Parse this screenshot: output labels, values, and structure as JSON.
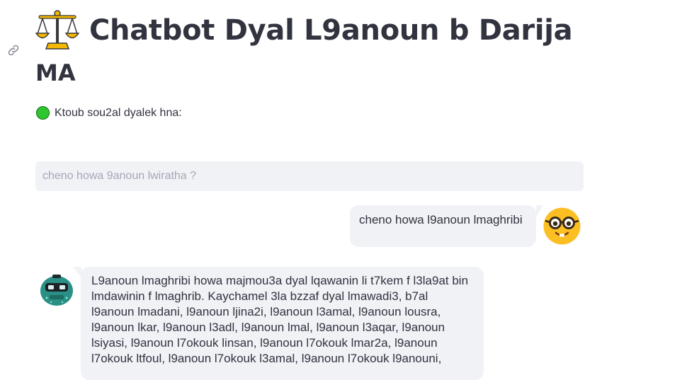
{
  "header": {
    "title_line1": "Chatbot Dyal L9anoun b Darija",
    "title_line2": "MA",
    "icon": "balance-scale-icon"
  },
  "prompt": {
    "label": "Ktoub sou2al dyalek hna:",
    "icon": "green-circle-icon"
  },
  "input": {
    "value": "",
    "placeholder": "cheno howa 9anoun lwiratha ?"
  },
  "chat": {
    "messages": [
      {
        "role": "user",
        "avatar": "nerd-face-icon",
        "text": "cheno howa l9anoun lmaghribi"
      },
      {
        "role": "bot",
        "avatar": "robot-icon",
        "text": "L9anoun lmaghribi howa majmou3a dyal lqawanin li t7kem f l3la9at bin lmdawinin f lmaghrib. Kaychamel 3la bzzaf dyal lmawadi3, b7al l9anoun lmadani, l9anoun ljina2i, l9anoun l3amal, l9anoun lousra, l9anoun lkar, l9anoun l3adl, l9anoun lmal, l9anoun l3aqar, l9anoun lsiyasi, l9anoun l7okouk linsan, l9anoun l7okouk lmar2a, l9anoun l7okouk ltfoul, l9anoun l7okouk l3amal, l9anoun l7okouk l9anouni,"
      }
    ]
  },
  "colors": {
    "text": "#31333f",
    "bubble_bg": "#f0f2f6",
    "input_bg": "#f0f2f6",
    "status_green": "#2ec52e"
  }
}
